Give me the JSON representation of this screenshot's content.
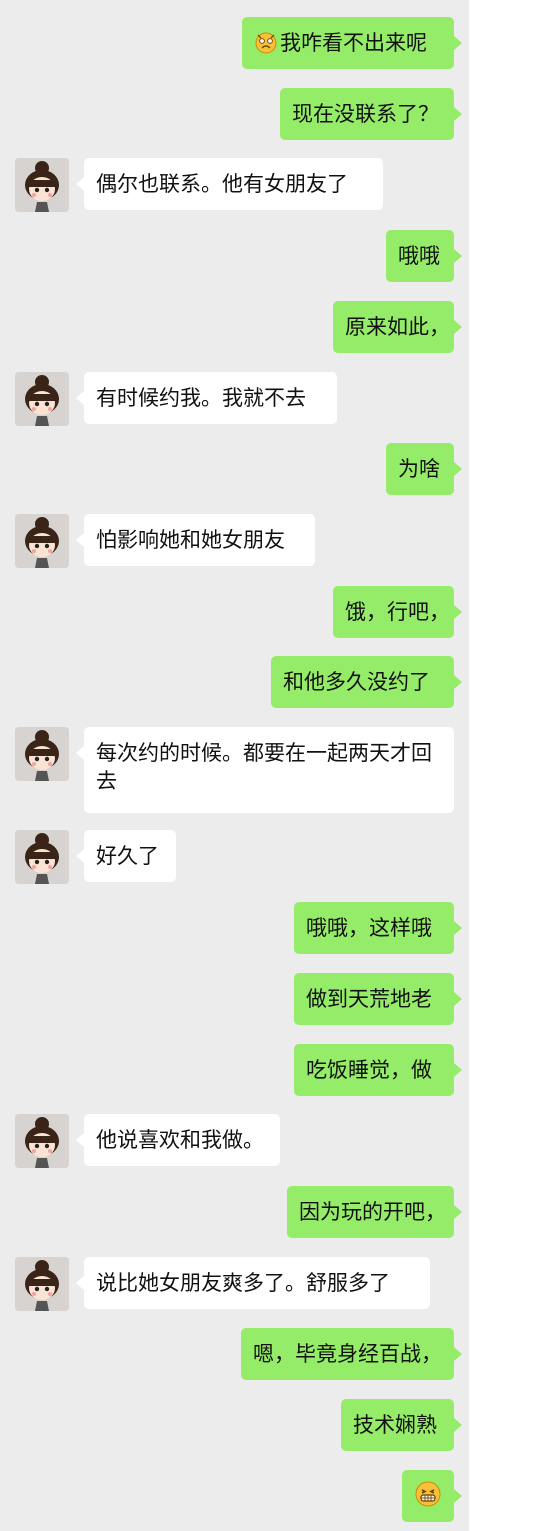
{
  "messages": [
    {
      "side": "out",
      "emoji": "sob-face-emoji",
      "text": "我咋看不出来呢"
    },
    {
      "side": "out",
      "text": "现在没联系了？"
    },
    {
      "side": "in",
      "text": "偶尔也联系。他有女朋友了"
    },
    {
      "side": "out",
      "text": "哦哦"
    },
    {
      "side": "out",
      "text": "原来如此，"
    },
    {
      "side": "in",
      "text": "有时候约我。我就不去"
    },
    {
      "side": "out",
      "text": "为啥"
    },
    {
      "side": "in",
      "text": "怕影响她和她女朋友"
    },
    {
      "side": "out",
      "text": "饿，行吧，"
    },
    {
      "side": "out",
      "text": "和他多久没约了"
    },
    {
      "side": "in",
      "text": "每次约的时候。都要在一起两天才回去"
    },
    {
      "side": "in",
      "text": "好久了"
    },
    {
      "side": "out",
      "text": "哦哦，这样哦"
    },
    {
      "side": "out",
      "text": "做到天荒地老"
    },
    {
      "side": "out",
      "text": "吃饭睡觉，做"
    },
    {
      "side": "in",
      "text": "他说喜欢和我做。"
    },
    {
      "side": "out",
      "text": "因为玩的开吧，"
    },
    {
      "side": "in",
      "text": "说比她女朋友爽多了。舒服多了"
    },
    {
      "side": "out",
      "text": "嗯，毕竟身经百战，"
    },
    {
      "side": "out",
      "text": "技术娴熟"
    },
    {
      "side": "out",
      "emoji": "grin-face-emoji",
      "text": ""
    }
  ],
  "colors": {
    "background": "#ececec",
    "outgoing_bubble": "#95ec69",
    "incoming_bubble": "#ffffff"
  }
}
